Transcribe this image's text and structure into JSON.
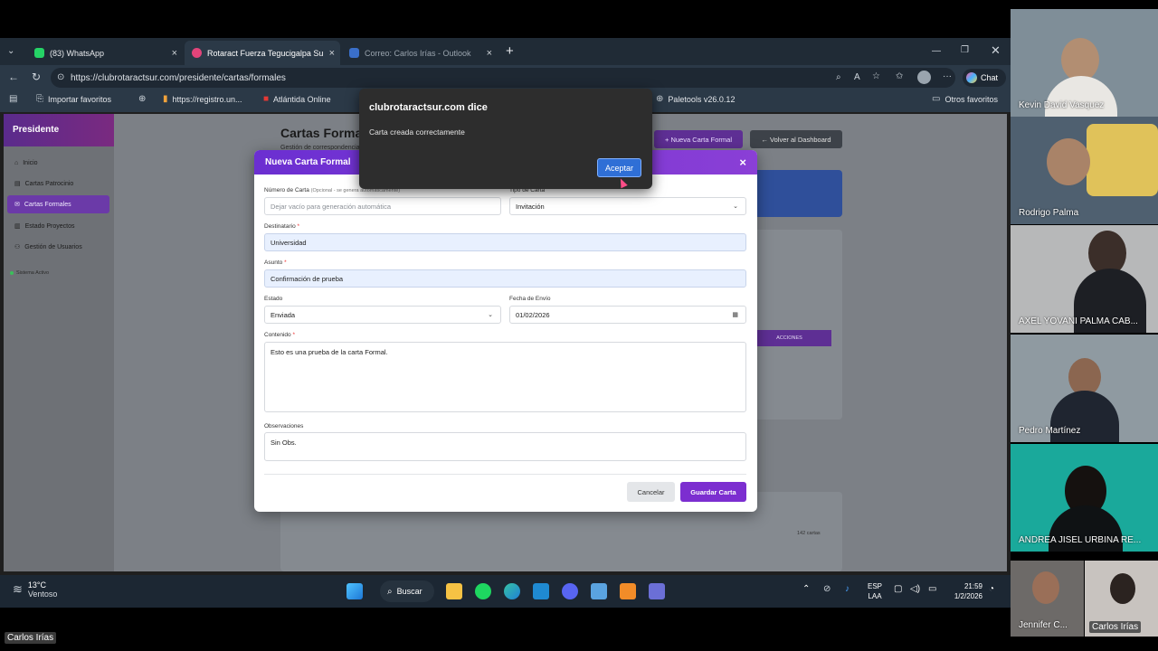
{
  "browser": {
    "tabs": [
      {
        "label": "(83) WhatsApp",
        "close": "×"
      },
      {
        "label": "Rotaract Fuerza Tegucigalpa Sur - ",
        "close": "×"
      },
      {
        "label": "Correo: Carlos Irías - Outlook",
        "close": "×"
      }
    ],
    "new_tab": "+",
    "url": "https://clubrotaractsur.com/presidente/cartas/formales",
    "chat_label": "Chat",
    "bookmarks": [
      {
        "label": "Importar favoritos"
      },
      {
        "label": "https://registro.un..."
      },
      {
        "label": "Atlántida Online"
      },
      {
        "label": "Paletools v26.0.12"
      }
    ],
    "other_favorites": "Otros favoritos"
  },
  "sidebar": {
    "title": "Presidente",
    "items": [
      {
        "label": "Inicio"
      },
      {
        "label": "Cartas Patrocinio"
      },
      {
        "label": "Cartas Formales"
      },
      {
        "label": "Estado Proyectos"
      },
      {
        "label": "Gestión de Usuarios"
      }
    ],
    "status": "Sistema Activo"
  },
  "page": {
    "title": "Cartas Formales",
    "subtitle": "Gestión de correspondencia",
    "new_button": "+ Nueva Carta Formal",
    "back_button": "← Volver al Dashboard",
    "actions_header": "ACCIONES",
    "count_label": "142 cartas"
  },
  "modal": {
    "title": "Nueva Carta Formal",
    "close": "×",
    "numero_label": "Número de Carta",
    "numero_hint": "(Opcional - se genera automáticamente)",
    "numero_placeholder": "Dejar vacío para generación automática",
    "tipo_label": "Tipo de Carta",
    "tipo_value": "Invitación",
    "destinatario_label": "Destinatario",
    "destinatario_value": "Universidad",
    "asunto_label": "Asunto",
    "asunto_value": "Confirmación de prueba",
    "estado_label": "Estado",
    "estado_value": "Enviada",
    "fecha_label": "Fecha de Envío",
    "fecha_value": "01/02/2026",
    "contenido_label": "Contenido",
    "contenido_value": "Esto es una prueba de la carta Formal.",
    "observaciones_label": "Observaciones",
    "observaciones_value": "Sin Obs.",
    "required_mark": "*",
    "cancel": "Cancelar",
    "save": "Guardar Carta"
  },
  "alert": {
    "title": "clubrotaractsur.com dice",
    "message": "Carta creada correctamente",
    "ok": "Aceptar"
  },
  "taskbar": {
    "temp": "13°C",
    "weather": "Ventoso",
    "search": "Buscar",
    "lang": "ESP",
    "lang2": "LAA",
    "time": "21:59",
    "date": "1/2/2026"
  },
  "meeting": {
    "participants": [
      {
        "name": "Kevin David Vasquez"
      },
      {
        "name": "Rodrigo Palma"
      },
      {
        "name": "AXEL YOVANI PALMA CAB..."
      },
      {
        "name": "Pedro Martínez"
      },
      {
        "name": "ANDREA JISEL URBINA RE..."
      },
      {
        "name": "Jennifer C..."
      },
      {
        "name": "Carlos Irías"
      }
    ],
    "presenter": "Carlos Irías"
  }
}
